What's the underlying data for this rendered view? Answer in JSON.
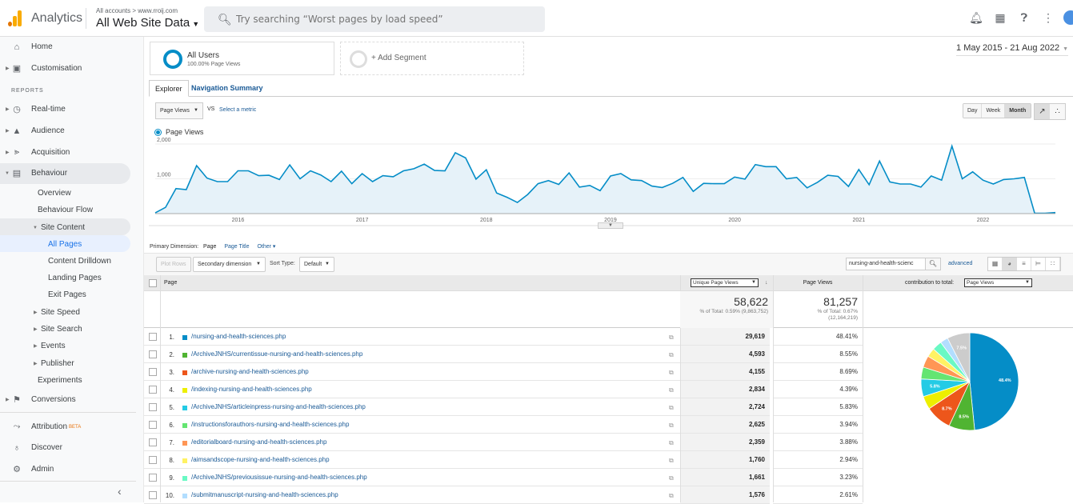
{
  "header": {
    "app_name": "Analytics",
    "account_crumb": "All accounts > www.rroij.com",
    "view_name": "All Web Site Data",
    "search_placeholder": "Try searching “Worst pages by load speed”",
    "icons": [
      "bell-icon",
      "apps-grid-icon",
      "help-icon",
      "more-vert-icon",
      "account-avatar"
    ]
  },
  "sidebar": {
    "home": "Home",
    "customisation": "Customisation",
    "reports_label": "REPORTS",
    "realtime": "Real-time",
    "audience": "Audience",
    "acquisition": "Acquisition",
    "behaviour": "Behaviour",
    "overview": "Overview",
    "behaviour_flow": "Behaviour Flow",
    "site_content": "Site Content",
    "all_pages": "All Pages",
    "content_drilldown": "Content Drilldown",
    "landing_pages": "Landing Pages",
    "exit_pages": "Exit Pages",
    "site_speed": "Site Speed",
    "site_search": "Site Search",
    "events": "Events",
    "publisher": "Publisher",
    "experiments": "Experiments",
    "conversions": "Conversions",
    "attribution": "Attribution",
    "beta": "BETA",
    "discover": "Discover",
    "admin": "Admin",
    "collapse": "‹"
  },
  "segments": {
    "all_users": "All Users",
    "all_users_sub": "100.00% Page Views",
    "add_segment": "+ Add Segment"
  },
  "date_range": "1 May 2015 - 21 Aug 2022",
  "tabs": {
    "explorer": "Explorer",
    "nav_summary": "Navigation Summary"
  },
  "chart_controls": {
    "metric": "Page Views",
    "vs": "VS",
    "select_metric": "Select a metric",
    "day": "Day",
    "week": "Week",
    "month": "Month"
  },
  "chart_data": {
    "type": "area",
    "title": "",
    "legend": [
      "Page Views"
    ],
    "xlabel": "",
    "ylabel": "",
    "ylim": [
      0,
      2000
    ],
    "yticks": [
      "1,000",
      "2,000"
    ],
    "ytick_values": [
      1000,
      2000
    ],
    "xticks": [
      "2016",
      "2017",
      "2018",
      "2019",
      "2020",
      "2021",
      "2022"
    ],
    "x_start": "2015-05",
    "x_interval": "month",
    "grid": true,
    "series": [
      {
        "name": "Page Views",
        "color": "#058dc7",
        "values": [
          20,
          180,
          720,
          690,
          1380,
          1020,
          920,
          920,
          1230,
          1230,
          1090,
          1100,
          980,
          1400,
          1000,
          1230,
          1110,
          920,
          1220,
          860,
          1150,
          920,
          1090,
          1060,
          1230,
          1290,
          1420,
          1240,
          1230,
          1750,
          1600,
          990,
          1260,
          590,
          470,
          320,
          550,
          860,
          950,
          840,
          1170,
          760,
          810,
          660,
          1080,
          1150,
          970,
          950,
          790,
          750,
          870,
          1040,
          640,
          870,
          860,
          860,
          1050,
          990,
          1410,
          1350,
          1350,
          1000,
          1040,
          740,
          900,
          1100,
          1070,
          780,
          1270,
          830,
          1510,
          910,
          850,
          850,
          760,
          1080,
          960,
          1940,
          1000,
          1200,
          960,
          850,
          980,
          1000,
          1040,
          10,
          10,
          30
        ]
      }
    ]
  },
  "table_controls": {
    "primary_dim_label": "Primary Dimension:",
    "primary_dim_current": "Page",
    "page_title": "Page Title",
    "other": "Other",
    "plot_rows": "Plot Rows",
    "secondary_dim": "Secondary dimension",
    "sort_type_label": "Sort Type:",
    "sort_type_value": "Default",
    "filter_value": "nursing-and-health-scienc",
    "advanced": "advanced"
  },
  "table": {
    "col_page": "Page",
    "col_unique": "Unique Page Views",
    "col_pageviews": "Page Views",
    "contribution_label": "contribution to total:",
    "contribution_value": "Page Views",
    "summary": {
      "unique_total": "58,622",
      "unique_sub": "% of Total: 0.59% (9,863,752)",
      "pv_total": "81,257",
      "pv_sub1": "% of Total: 0.67%",
      "pv_sub2": "(12,164,219)"
    },
    "rows": [
      {
        "n": "1.",
        "page": "/nursing-and-health-sciences.php",
        "color": "#058dc7",
        "uv": "29,619",
        "pv": "48.41%"
      },
      {
        "n": "2.",
        "page": "/ArchiveJNHS/currentissue-nursing-and-health-sciences.php",
        "color": "#50b432",
        "uv": "4,593",
        "pv": "8.55%"
      },
      {
        "n": "3.",
        "page": "/archive-nursing-and-health-sciences.php",
        "color": "#ed561b",
        "uv": "4,155",
        "pv": "8.69%"
      },
      {
        "n": "4.",
        "page": "/indexing-nursing-and-health-sciences.php",
        "color": "#edef00",
        "uv": "2,834",
        "pv": "4.39%"
      },
      {
        "n": "5.",
        "page": "/ArchiveJNHS/articleinpress-nursing-and-health-sciences.php",
        "color": "#24cbe5",
        "uv": "2,724",
        "pv": "5.83%"
      },
      {
        "n": "6.",
        "page": "/instructionsforauthors-nursing-and-health-sciences.php",
        "color": "#64e572",
        "uv": "2,625",
        "pv": "3.94%"
      },
      {
        "n": "7.",
        "page": "/editorialboard-nursing-and-health-sciences.php",
        "color": "#ff9655",
        "uv": "2,359",
        "pv": "3.88%"
      },
      {
        "n": "8.",
        "page": "/aimsandscope-nursing-and-health-sciences.php",
        "color": "#fff263",
        "uv": "1,760",
        "pv": "2.94%"
      },
      {
        "n": "9.",
        "page": "/ArchiveJNHS/previousissue-nursing-and-health-sciences.php",
        "color": "#6af9c4",
        "uv": "1,661",
        "pv": "3.23%"
      },
      {
        "n": "10.",
        "page": "/submitmanuscript-nursing-and-health-sciences.php",
        "color": "#b2deff",
        "uv": "1,576",
        "pv": "2.61%"
      }
    ]
  },
  "pie": {
    "slices": [
      {
        "value": 48.41,
        "color": "#058dc7",
        "label": "48.4%"
      },
      {
        "value": 8.55,
        "color": "#50b432",
        "label": "8.5%"
      },
      {
        "value": 8.69,
        "color": "#ed561b",
        "label": "8.7%"
      },
      {
        "value": 4.39,
        "color": "#edef00",
        "label": ""
      },
      {
        "value": 5.83,
        "color": "#24cbe5",
        "label": "5.8%"
      },
      {
        "value": 3.94,
        "color": "#64e572",
        "label": ""
      },
      {
        "value": 3.88,
        "color": "#ff9655",
        "label": ""
      },
      {
        "value": 2.94,
        "color": "#fff263",
        "label": ""
      },
      {
        "value": 3.23,
        "color": "#6af9c4",
        "label": ""
      },
      {
        "value": 2.61,
        "color": "#b2deff",
        "label": ""
      },
      {
        "value": 7.53,
        "color": "#cccccc",
        "label": "7.5%"
      }
    ]
  }
}
